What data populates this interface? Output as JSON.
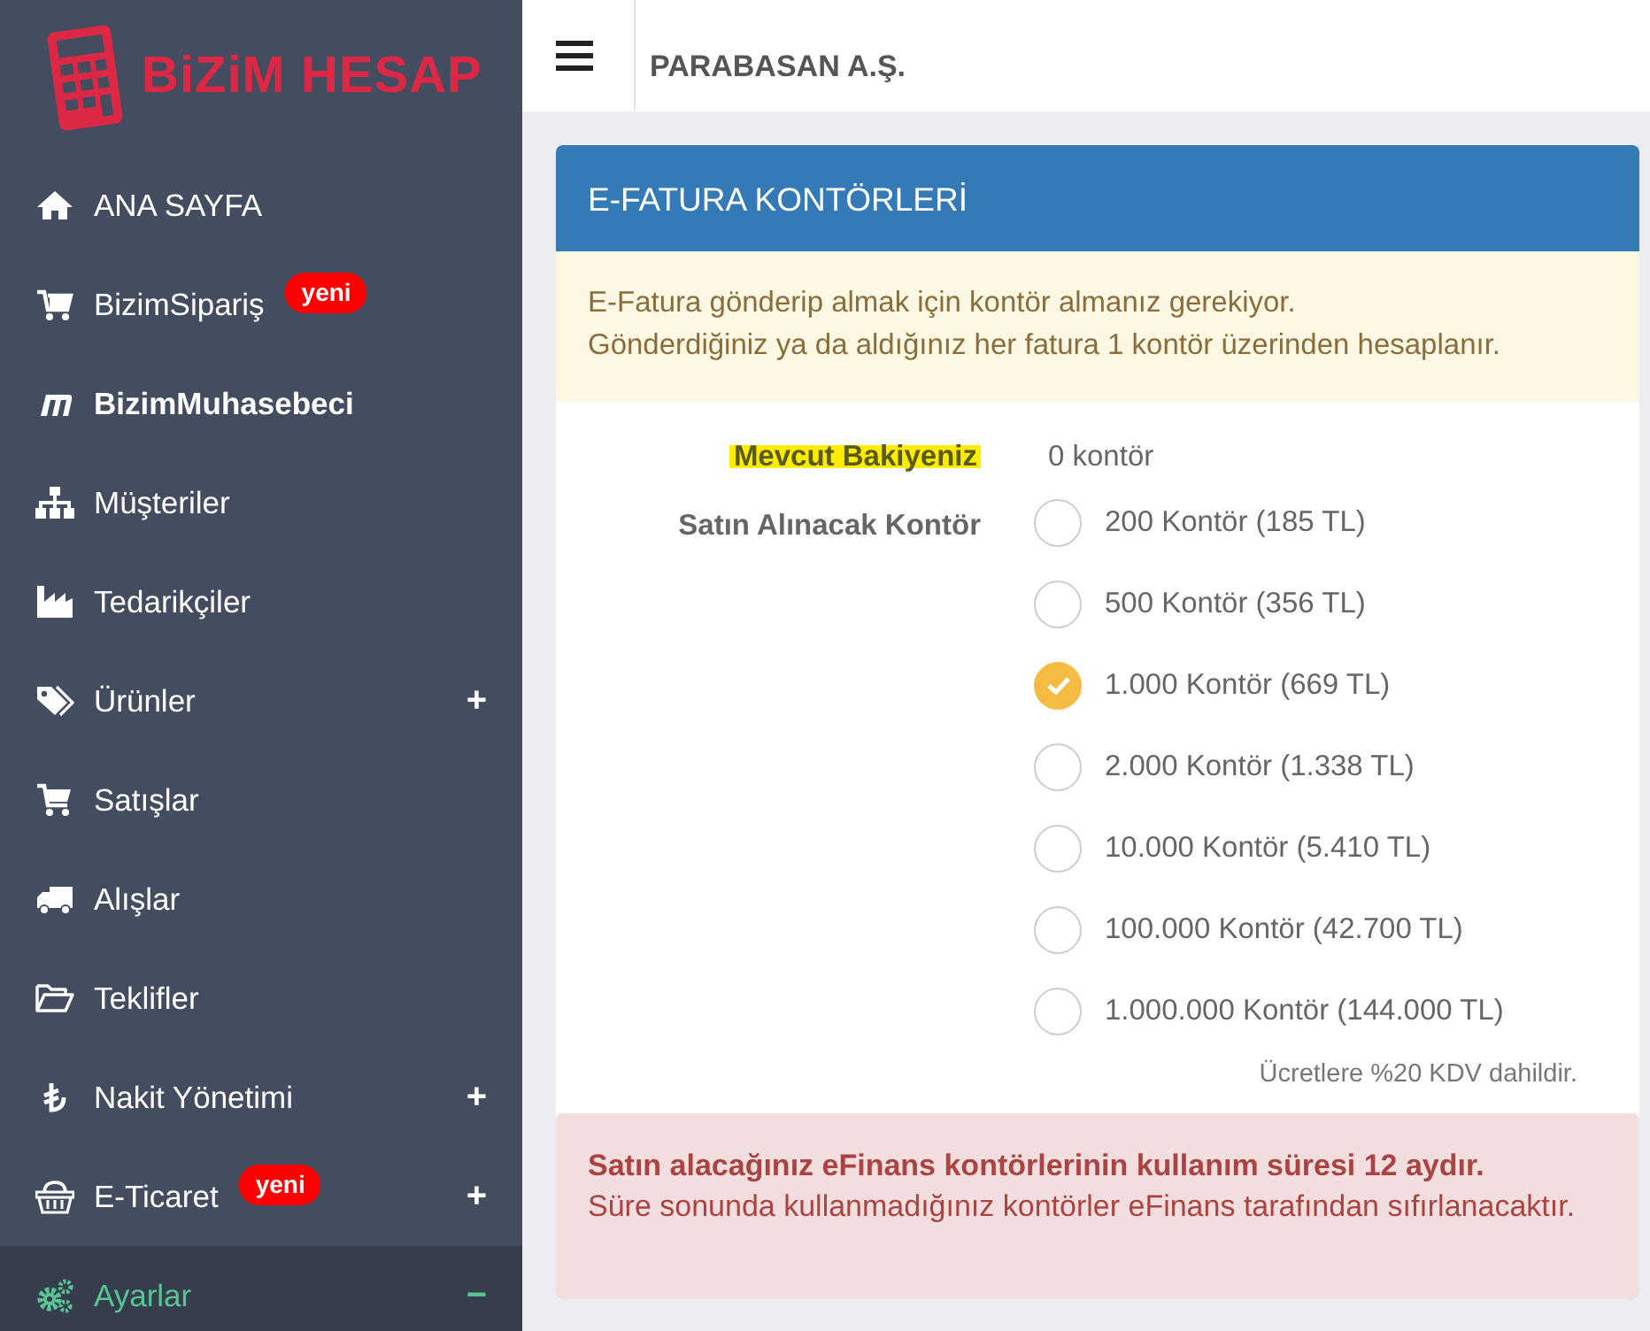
{
  "brand": {
    "name": "BiZiM HESAP"
  },
  "sidebar": {
    "items": [
      {
        "label": "ANA SAYFA",
        "selected": false,
        "bold": false
      },
      {
        "label": "BizimSipariş",
        "selected": false,
        "bold": false,
        "badge": "yeni"
      },
      {
        "label": "BizimMuhasebeci",
        "selected": false,
        "bold": true
      },
      {
        "label": "Müşteriler",
        "selected": false,
        "bold": false
      },
      {
        "label": "Tedarikçiler",
        "selected": false,
        "bold": false
      },
      {
        "label": "Ürünler",
        "selected": false,
        "bold": false,
        "toggle": "+"
      },
      {
        "label": "Satışlar",
        "selected": false,
        "bold": false
      },
      {
        "label": "Alışlar",
        "selected": false,
        "bold": false
      },
      {
        "label": "Teklifler",
        "selected": false,
        "bold": false
      },
      {
        "label": "Nakit Yönetimi",
        "selected": false,
        "bold": false,
        "toggle": "+"
      },
      {
        "label": "E-Ticaret",
        "selected": false,
        "bold": false,
        "badge": "yeni",
        "toggle": "+"
      },
      {
        "label": "Ayarlar",
        "selected": true,
        "bold": false,
        "toggle": "−"
      }
    ]
  },
  "topbar": {
    "company": "PARABASAN A.Ş."
  },
  "card": {
    "title": "E-FATURA KONTÖRLERİ",
    "info": [
      "E-Fatura gönderip almak için kontör almanız gerekiyor.",
      "Gönderdiğiniz ya da aldığınız her fatura 1 kontör üzerinden hesaplanır."
    ],
    "balance": {
      "label": "Mevcut Bakiyeniz",
      "highlighted": true,
      "value": "0 kontör"
    },
    "purchase": {
      "label": "Satın Alınacak Kontör",
      "options": [
        {
          "label": "200 Kontör (185 TL)",
          "selected": false
        },
        {
          "label": "500 Kontör (356 TL)",
          "selected": false
        },
        {
          "label": "1.000 Kontör (669 TL)",
          "selected": true
        },
        {
          "label": "2.000 Kontör (1.338 TL)",
          "selected": false
        },
        {
          "label": "10.000 Kontör (5.410 TL)",
          "selected": false
        },
        {
          "label": "100.000 Kontör (42.700 TL)",
          "selected": false
        },
        {
          "label": "1.000.000 Kontör (144.000 TL)",
          "selected": false
        }
      ]
    },
    "note": "Ücretlere %20 KDV dahildir.",
    "alert": {
      "title": "Satın alacağınız eFinans kontörlerinin kullanım süresi 12 aydır.",
      "text": "Süre sonunda kullanmadığınız kontörler eFinans tarafından sıfırlanacaktır."
    }
  }
}
